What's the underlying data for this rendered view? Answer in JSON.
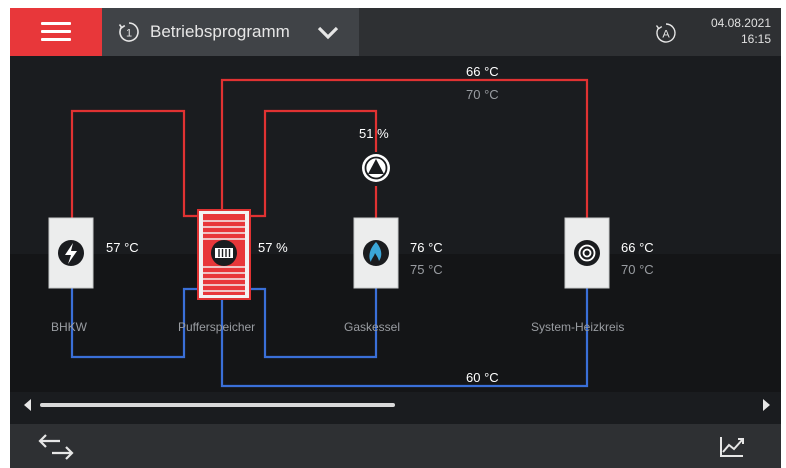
{
  "header": {
    "menu_icon": "hamburger-menu-icon",
    "program_icon": "program-1-icon",
    "program_label": "Betriebsprogramm",
    "program_dropdown_icon": "chevron-down-icon",
    "auto_icon": "auto-mode-icon",
    "date": "04.08.2021",
    "time": "16:15"
  },
  "components": {
    "bhkw": {
      "name": "BHKW",
      "temp": "57 °C",
      "icon": "lightning-icon"
    },
    "puffer": {
      "name": "Pufferspeicher",
      "level": "57 %",
      "icon": "buffer-tank-icon"
    },
    "gaskessel": {
      "name": "Gaskessel",
      "temp": "76 °C",
      "setpoint": "75 °C",
      "icon": "flame-icon"
    },
    "heizkreis": {
      "name": "System-Heizkreis",
      "temp": "66 °C",
      "setpoint": "70 °C",
      "icon": "radiator-circle-icon"
    }
  },
  "lines": {
    "supply_temp": "66 °C",
    "supply_setpoint": "70 °C",
    "return_temp": "60 °C",
    "pump_speed": "51 %",
    "pump_icon": "pump-icon"
  },
  "scroll": {
    "position": 0.5
  },
  "footer": {
    "switch_icon": "switch-view-arrows-icon",
    "trend_icon": "trend-chart-icon"
  },
  "colors": {
    "accent": "#e8373a",
    "supply_line": "#e03232",
    "return_line": "#3a6fd8",
    "background": "#1a1c1f"
  }
}
